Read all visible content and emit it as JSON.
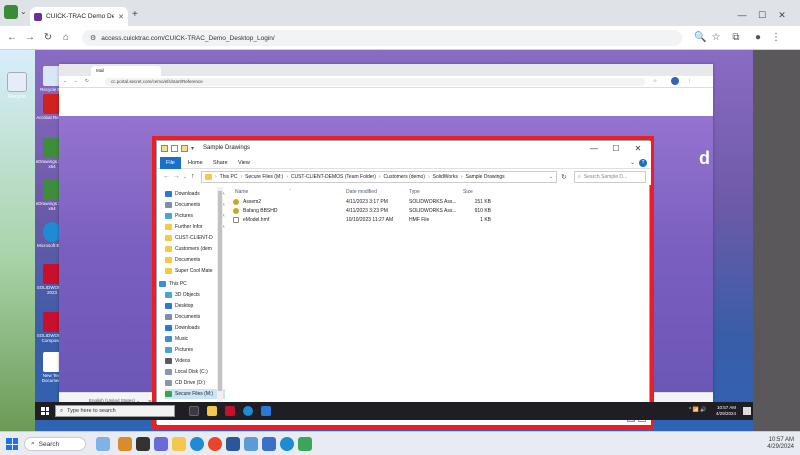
{
  "outer_browser": {
    "tab_title": "CUICK-TRAC Demo Desktop Lo",
    "url": "access.cuicktrac.com/CUICK-TRAC_Demo_Desktop_Login/",
    "controls": {
      "minimize": "—",
      "maximize": "☐",
      "close": "✕"
    },
    "new_tab": "+",
    "close_tab": "✕"
  },
  "local_desktop": {
    "icons": [
      {
        "label": "Recycle"
      }
    ]
  },
  "remote_desktop": {
    "icons": [
      {
        "label": "Recycle Bin",
        "color": "#d9e6f5"
      },
      {
        "label": "Acrobat Reader",
        "color": "#d21f1f"
      },
      {
        "label": "eDrawings 2023 x64",
        "color": "#3d8d3d"
      },
      {
        "label": "eDrawings 2024 x64",
        "color": "#3d8d3d"
      },
      {
        "label": "Microsoft Edge",
        "color": "#1f8bd4"
      },
      {
        "label": "SOLIDWORKS 2023",
        "color": "#c8102e"
      },
      {
        "label": "SOLIDWORKS Composer",
        "color": "#c8102e"
      },
      {
        "label": "New Text Document",
        "color": "#ffffff"
      }
    ]
  },
  "inner_browser": {
    "tab_title": "Mail",
    "url": "cc.portal.secret.com/cemo/efs/start/Reference",
    "footer": [
      "English (United States) ⌄",
      "Terms of Access",
      "Privacy",
      "Contact Us",
      "Help"
    ],
    "page_letter": "d"
  },
  "explorer": {
    "title": "Sample Drawings",
    "ribbon_tabs": [
      "File",
      "Home",
      "Share",
      "View"
    ],
    "path": [
      "This PC",
      "Secure Files (M:)",
      "CUST-CLIENT-DEMOS (Team Folder)",
      "Customers (demo)",
      "SolidWorks",
      "Sample Drawings"
    ],
    "search_placeholder": "Search Sample D...",
    "nav_items": [
      {
        "label": "Downloads",
        "icon": "downloads-icon",
        "color": "#2b79d6",
        "pinned": true
      },
      {
        "label": "Documents",
        "icon": "documents-icon",
        "color": "#7d8ea8",
        "pinned": true
      },
      {
        "label": "Pictures",
        "icon": "pictures-icon",
        "color": "#4aa3df",
        "pinned": true
      },
      {
        "label": "Further Infor",
        "icon": "folder-icon",
        "color": "#f4c84a",
        "pinned": true
      },
      {
        "label": "CUST-CLIENT-D",
        "icon": "folder-icon",
        "color": "#f4c84a",
        "pinned": false
      },
      {
        "label": "Customers (dem",
        "icon": "folder-icon",
        "color": "#f4c84a",
        "pinned": false
      },
      {
        "label": "Documents",
        "icon": "folder-icon",
        "color": "#f4c84a",
        "pinned": false
      },
      {
        "label": "Super Cool Mate",
        "icon": "folder-icon",
        "color": "#f4c84a",
        "pinned": false
      },
      {
        "label": "This PC",
        "icon": "pc-icon",
        "color": "#3b8fd8",
        "pinned": false
      },
      {
        "label": "3D Objects",
        "icon": "3d-objects-icon",
        "color": "#4aa3df",
        "pinned": false
      },
      {
        "label": "Desktop",
        "icon": "desktop-icon",
        "color": "#2b79d6",
        "pinned": false
      },
      {
        "label": "Documents",
        "icon": "documents-icon",
        "color": "#7d8ea8",
        "pinned": false
      },
      {
        "label": "Downloads",
        "icon": "downloads-icon",
        "color": "#2b79d6",
        "pinned": false
      },
      {
        "label": "Music",
        "icon": "music-icon",
        "color": "#3b8fd8",
        "pinned": false
      },
      {
        "label": "Pictures",
        "icon": "pictures-icon",
        "color": "#4aa3df",
        "pinned": false
      },
      {
        "label": "Videos",
        "icon": "videos-icon",
        "color": "#555b66",
        "pinned": false
      },
      {
        "label": "Local Disk (C:)",
        "icon": "disk-icon",
        "color": "#8a97a8",
        "pinned": false
      },
      {
        "label": "CD Drive (D:)",
        "icon": "cd-icon",
        "color": "#8a97a8",
        "pinned": false
      },
      {
        "label": "Secure Files (M:)",
        "icon": "network-drive-icon",
        "color": "#3fa34d",
        "pinned": false
      },
      {
        "label": "Network",
        "icon": "network-icon",
        "color": "#2b79d6",
        "pinned": false
      }
    ],
    "columns": [
      "Name",
      "Date modified",
      "Type",
      "Size"
    ],
    "files": [
      {
        "name": "Assem2",
        "date": "4/11/2023 3:17 PM",
        "type": "SOLIDWORKS Ass...",
        "size": "151 KB",
        "icon_color": "#c9a825"
      },
      {
        "name": "Bafang BBSHD",
        "date": "4/11/2023 3:23 PM",
        "type": "SOLIDWORKS Ass...",
        "size": "910 KB",
        "icon_color": "#c9a825"
      },
      {
        "name": "eModel.hmf",
        "date": "10/10/2023 11:27 AM",
        "type": "HMF File",
        "size": "1 KB",
        "icon_color": "#ffffff"
      }
    ],
    "status": "3 items"
  },
  "remote_taskbar": {
    "search_placeholder": "Type here to search",
    "time": "10:57 AM",
    "date": "4/29/2024",
    "tray": "^ 📶 🔊"
  },
  "local_taskbar": {
    "search_placeholder": "Search",
    "time": "10:57 AM",
    "date": "4/29/2024"
  }
}
